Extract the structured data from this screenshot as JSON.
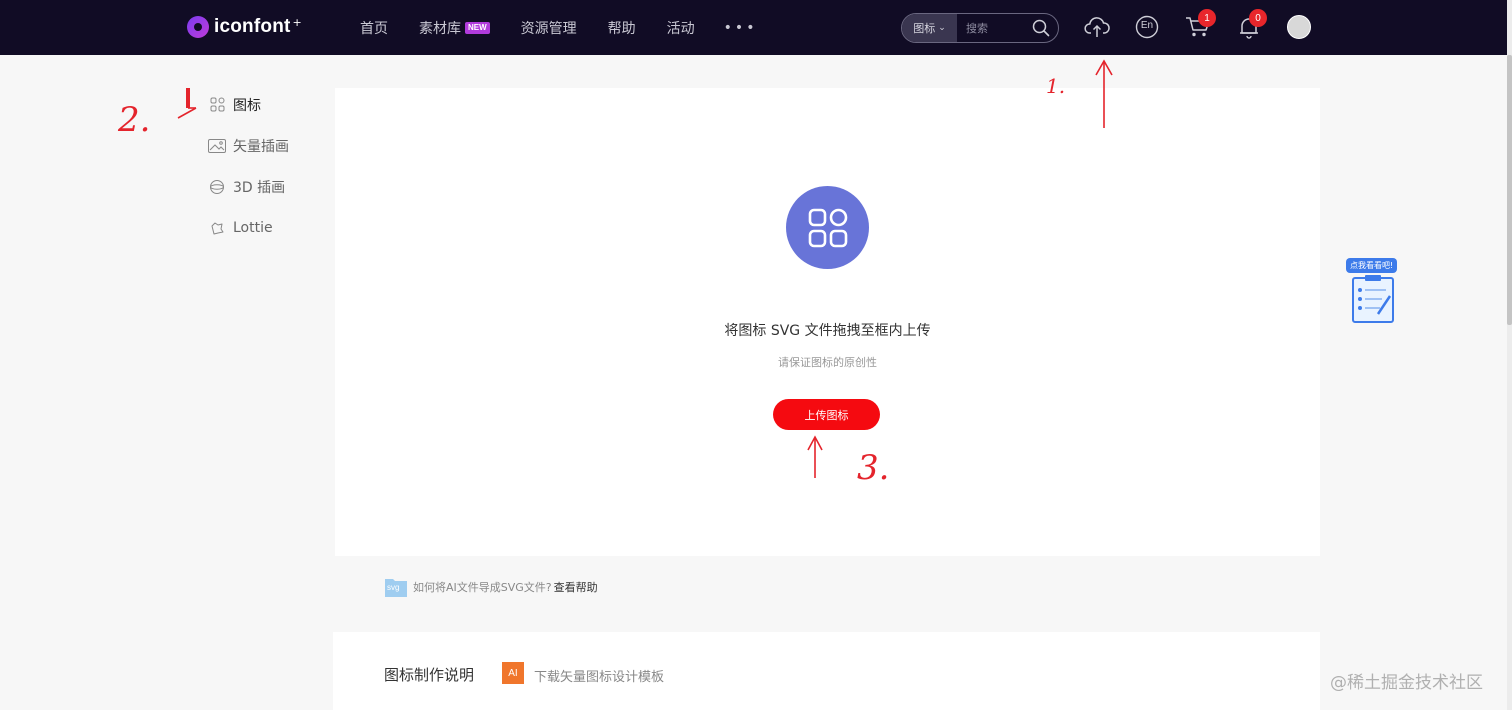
{
  "brand": {
    "name": "iconfont",
    "plus": "+"
  },
  "nav": {
    "items": [
      {
        "label": "首页"
      },
      {
        "label": "素材库",
        "badge": "NEW"
      },
      {
        "label": "资源管理"
      },
      {
        "label": "帮助"
      },
      {
        "label": "活动"
      }
    ],
    "more": "•••"
  },
  "search": {
    "type": "图标",
    "placeholder": "搜索"
  },
  "toolbar": {
    "lang": "En",
    "cart_count": "1",
    "notice_count": "0"
  },
  "sidebar": {
    "items": [
      {
        "label": "图标",
        "icon": "grid-icon",
        "active": true
      },
      {
        "label": "矢量插画",
        "icon": "image-icon"
      },
      {
        "label": "3D 插画",
        "icon": "sphere-icon"
      },
      {
        "label": "Lottie",
        "icon": "lottie-icon"
      }
    ]
  },
  "upload": {
    "title": "将图标 SVG 文件拖拽至框内上传",
    "subtitle": "请保证图标的原创性",
    "button": "上传图标"
  },
  "help": {
    "tag": "svg",
    "text": "如何将AI文件导成SVG文件?",
    "link": "查看帮助"
  },
  "guide": {
    "title": "图标制作说明",
    "ai_badge": "AI",
    "template_link": "下载矢量图标设计模板"
  },
  "float_help": {
    "tip": "点我看看吧!"
  },
  "annotations": {
    "one": "1.",
    "two": "2.",
    "three": "3."
  },
  "watermark": "@稀土掘金技术社区",
  "colors": {
    "topbar": "#110c25",
    "accent_red": "#f50a10",
    "upload_circle": "#6874d8",
    "annotation": "#e4242c"
  }
}
